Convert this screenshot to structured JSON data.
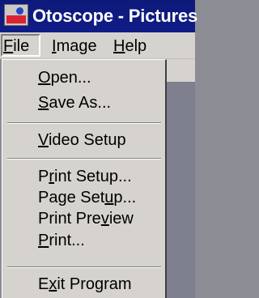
{
  "window": {
    "title": "Otoscope - Pictures"
  },
  "menubar": {
    "items": [
      {
        "pre": "",
        "u": "F",
        "post": "ile"
      },
      {
        "pre": "",
        "u": "I",
        "post": "mage"
      },
      {
        "pre": "",
        "u": "H",
        "post": "elp"
      }
    ]
  },
  "file_menu": {
    "items": [
      {
        "pre": "",
        "u": "O",
        "post": "pen..."
      },
      {
        "pre": "",
        "u": "S",
        "post": "ave As..."
      },
      {
        "pre": "",
        "u": "V",
        "post": "ideo Setup"
      },
      {
        "pre": "P",
        "u": "r",
        "post": "int Setup..."
      },
      {
        "pre": "Page Set",
        "u": "u",
        "post": "p..."
      },
      {
        "pre": "Print Pre",
        "u": "v",
        "post": "iew"
      },
      {
        "pre": "",
        "u": "P",
        "post": "rint..."
      },
      {
        "pre": "E",
        "u": "x",
        "post": "it Program"
      }
    ]
  }
}
